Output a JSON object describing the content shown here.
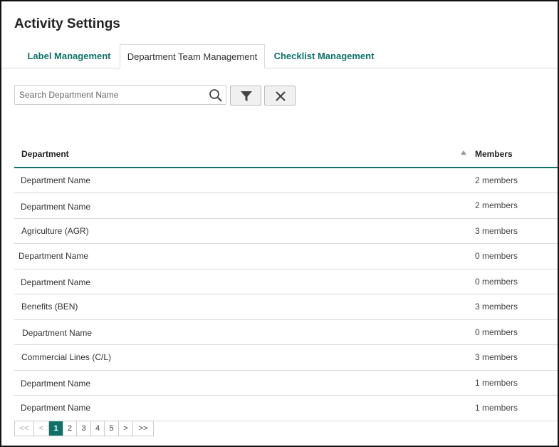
{
  "page": {
    "title": "Activity Settings"
  },
  "tabs": [
    {
      "label": "Label Management"
    },
    {
      "label": "Department Team Management"
    },
    {
      "label": "Checklist Management"
    }
  ],
  "search": {
    "placeholder": "Search Department Name",
    "value": ""
  },
  "table": {
    "headers": {
      "department": "Department",
      "members": "Members"
    },
    "rows": [
      {
        "department": "Department Name",
        "members": "2 members"
      },
      {
        "department": "Department Name",
        "members": "2 members"
      },
      {
        "department": "Agriculture (AGR)",
        "members": "3 members"
      },
      {
        "department": "Department Name",
        "members": "0 members"
      },
      {
        "department": "Department Name",
        "members": "0 members"
      },
      {
        "department": "Benefits (BEN)",
        "members": "3 members"
      },
      {
        "department": "Department Name",
        "members": "0 members"
      },
      {
        "department": "Commercial Lines (C/L)",
        "members": "3 members"
      },
      {
        "department": "Department Name",
        "members": "1 members"
      },
      {
        "department": "Department Name",
        "members": "1 members"
      }
    ]
  },
  "pager": {
    "first": "<<",
    "prev": "<",
    "pages": [
      "1",
      "2",
      "3",
      "4",
      "5"
    ],
    "next": ">",
    "last": ">>",
    "current": "1"
  },
  "colors": {
    "accent": "#0e7366",
    "border": "#d9d9d9"
  },
  "icons": [
    "search-icon",
    "filter-icon",
    "close-icon",
    "sort-asc-icon"
  ]
}
